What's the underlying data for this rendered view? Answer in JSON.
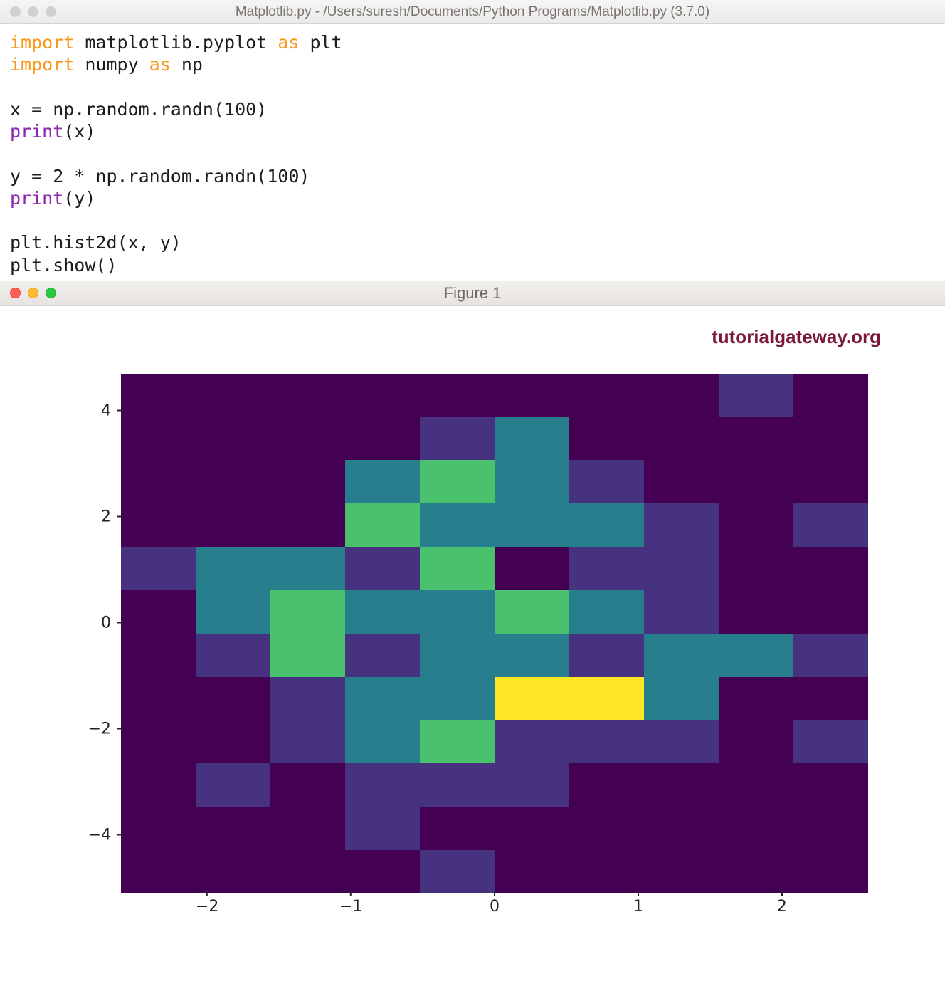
{
  "editor_window": {
    "title": "Matplotlib.py - /Users/suresh/Documents/Python Programs/Matplotlib.py (3.7.0)",
    "traffic_inactive": true
  },
  "code": {
    "tokens": [
      [
        {
          "t": "import",
          "c": "kw-orange"
        },
        {
          "t": " matplotlib.pyplot "
        },
        {
          "t": "as",
          "c": "kw-orange"
        },
        {
          "t": " plt"
        }
      ],
      [
        {
          "t": "import",
          "c": "kw-orange"
        },
        {
          "t": " numpy "
        },
        {
          "t": "as",
          "c": "kw-orange"
        },
        {
          "t": " np"
        }
      ],
      [],
      [
        {
          "t": "x = np.random.randn(100)"
        }
      ],
      [
        {
          "t": "print",
          "c": "kw-purple"
        },
        {
          "t": "(x)"
        }
      ],
      [],
      [
        {
          "t": "y = 2 * np.random.randn(100)"
        }
      ],
      [
        {
          "t": "print",
          "c": "kw-purple"
        },
        {
          "t": "(y)"
        }
      ],
      [],
      [
        {
          "t": "plt.hist2d(x, y)"
        }
      ],
      [
        {
          "t": "plt.show()"
        }
      ]
    ]
  },
  "figure_window": {
    "title": "Figure 1",
    "watermark": "tutorialgateway.org"
  },
  "chart_data": {
    "type": "heatmap",
    "title": "",
    "xlabel": "",
    "ylabel": "",
    "x_ticks": [
      -2,
      -1,
      0,
      1,
      2
    ],
    "y_ticks": [
      -4,
      -2,
      0,
      2,
      4
    ],
    "xlim": [
      -2.6,
      2.6
    ],
    "ylim": [
      -5.1,
      4.7
    ],
    "nbins_x": 10,
    "nbins_y": 10,
    "colormap": "viridis",
    "counts": [
      [
        0,
        0,
        0,
        0,
        0,
        0,
        0,
        0,
        1,
        0
      ],
      [
        0,
        0,
        0,
        0,
        1,
        2,
        0,
        0,
        0,
        0
      ],
      [
        0,
        0,
        0,
        2,
        3,
        2,
        1,
        0,
        0,
        0
      ],
      [
        0,
        0,
        0,
        3,
        2,
        2,
        2,
        1,
        0,
        1
      ],
      [
        1,
        2,
        2,
        1,
        3,
        0,
        1,
        1,
        0,
        0
      ],
      [
        0,
        2,
        3,
        2,
        2,
        3,
        2,
        1,
        0,
        0
      ],
      [
        0,
        1,
        3,
        1,
        2,
        2,
        1,
        2,
        2,
        1
      ],
      [
        0,
        0,
        1,
        2,
        2,
        5,
        5,
        2,
        0,
        0
      ],
      [
        0,
        0,
        1,
        2,
        3,
        1,
        1,
        1,
        0,
        1
      ],
      [
        0,
        1,
        0,
        1,
        1,
        1,
        0,
        0,
        0,
        0
      ],
      [
        0,
        0,
        0,
        1,
        0,
        0,
        0,
        0,
        0,
        0
      ],
      [
        0,
        0,
        0,
        0,
        1,
        0,
        0,
        0,
        0,
        0
      ]
    ],
    "note": "counts rows indexed top-to-bottom (high y to low y); values are approximate bin counts read from cell shades"
  },
  "viridis_map": {
    "0": "#440154",
    "1": "#46327e",
    "2": "#277f8e",
    "3": "#4ac16d",
    "4": "#a0da39",
    "5": "#fde725"
  }
}
